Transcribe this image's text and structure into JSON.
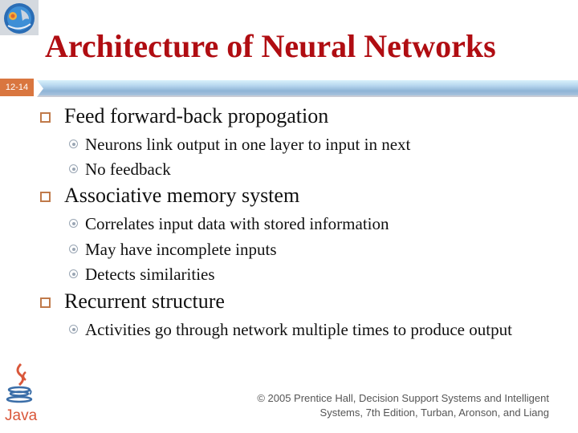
{
  "slide": {
    "title": "Architecture of Neural Networks",
    "slide_number": "12-14",
    "bullets": [
      {
        "text": "Feed forward-back propogation",
        "sub": [
          "Neurons link output in one layer to input in next",
          "No feedback"
        ]
      },
      {
        "text": "Associative memory system",
        "sub": [
          "Correlates input data with stored information",
          "May have incomplete inputs",
          "Detects similarities"
        ]
      },
      {
        "text": "Recurrent structure",
        "sub": [
          "Activities go through network multiple times to produce output"
        ]
      }
    ],
    "footer": {
      "line1": "© 2005  Prentice Hall, Decision Support Systems and Intelligent",
      "line2": "Systems, 7th Edition, Turban, Aronson, and Liang"
    },
    "java_logo_text": "Java"
  },
  "colors": {
    "title": "#b00d12",
    "slide_number_bg": "#d9763f",
    "bullet_square": "#c07a4a",
    "sub_bullet": "#9aa6b4"
  }
}
